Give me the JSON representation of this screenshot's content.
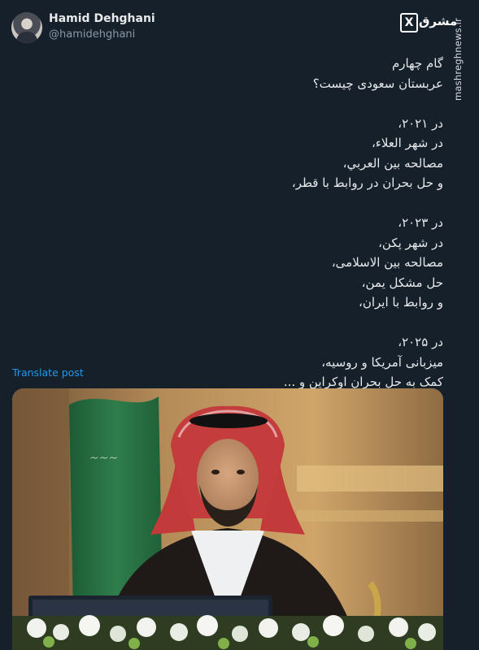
{
  "author": {
    "name": "Hamid Dehghani",
    "handle": "@hamidehghani"
  },
  "watermark": {
    "logo_text": "مشرق",
    "logo_mark": "X",
    "site": "mashreghnews.ir"
  },
  "tweet": {
    "lines": [
      "گام چهارم",
      "عربستان سعودی چیست؟",
      "",
      "در ۲۰۲۱،",
      "در شهر العلاء،",
      "مصالحه بین العربي،",
      "و حل بحران در روابط با قطر،",
      "",
      "در ۲۰۲۳،",
      "در شهر پکن،",
      "مصالحه بین الاسلامی،",
      "حل مشکل یمن،",
      "و روابط با ایران،",
      "",
      "در ۲۰۲۵،",
      "میزبانی آمریکا و روسیه،",
      "کمک به حل بحران اوکراین و ..."
    ]
  },
  "translate_label": "Translate post",
  "colors": {
    "background": "#15202b",
    "text": "#e7e9ea",
    "muted": "#8b98a5",
    "link": "#1d9bf0"
  }
}
